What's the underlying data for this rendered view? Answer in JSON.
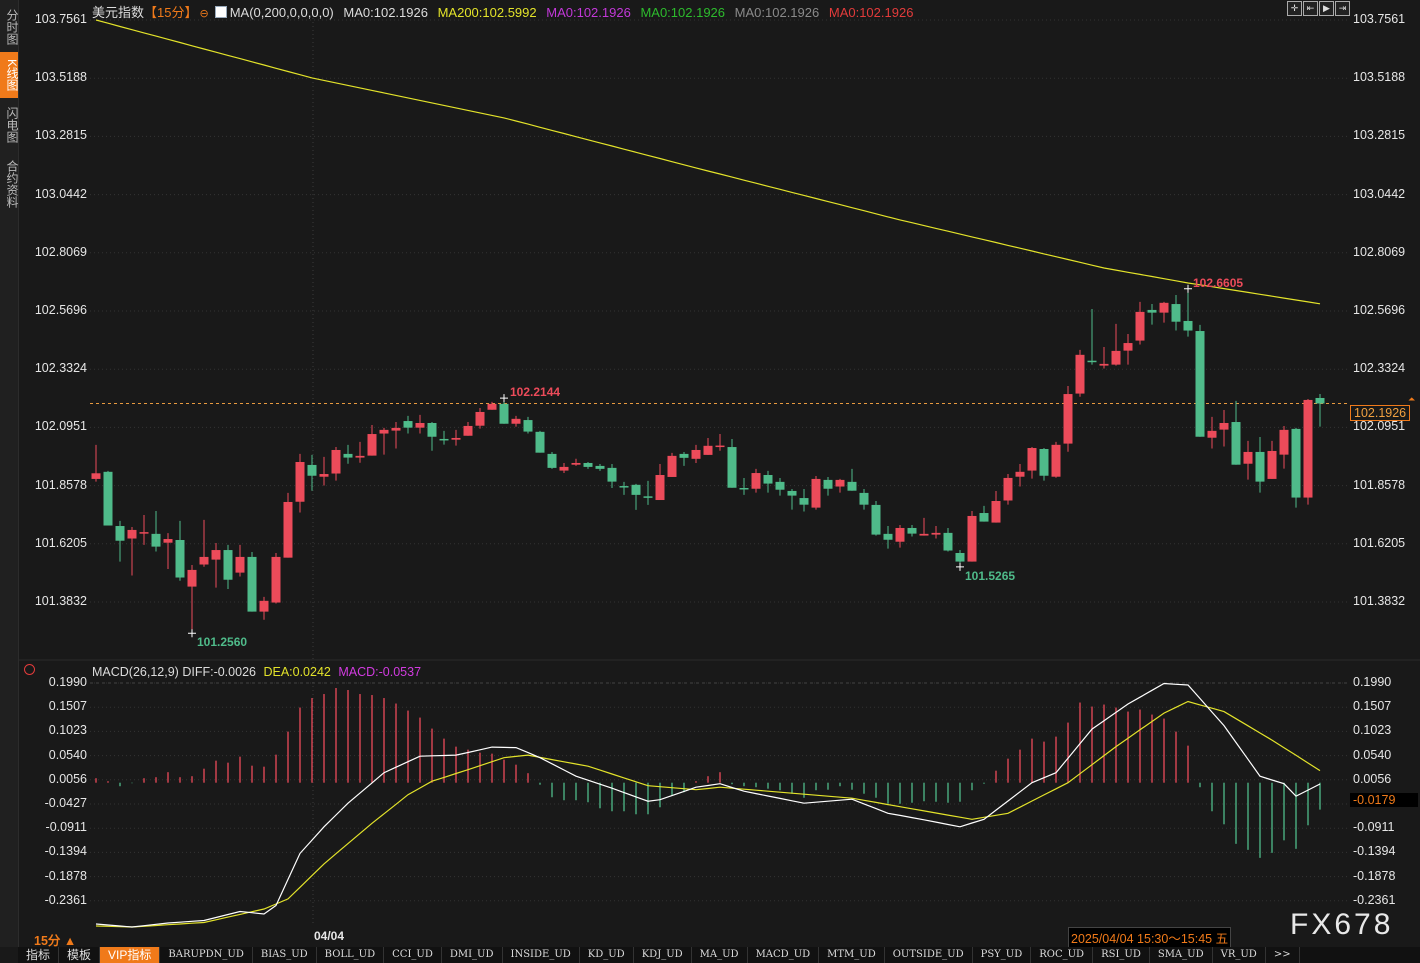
{
  "sidebar": {
    "tabs": [
      {
        "label": "分时图",
        "active": false
      },
      {
        "label": "K线图",
        "active": true
      },
      {
        "label": "闪电图",
        "active": false
      },
      {
        "label": "合约资料",
        "active": false
      }
    ]
  },
  "header": {
    "symbol": "美元指数",
    "period": "【15分】",
    "ma_label": "MA(0,200,0,0,0,0)",
    "ma_values": [
      {
        "text": "MA0:102.1926",
        "color": "#dcdcdc"
      },
      {
        "text": "MA200:102.5992",
        "color": "#e3e32a"
      },
      {
        "text": "MA0:102.1926",
        "color": "#c238d8"
      },
      {
        "text": "MA0:102.1926",
        "color": "#2dbb2d"
      },
      {
        "text": "MA0:102.1926",
        "color": "#8a8a8a"
      },
      {
        "text": "MA0:102.1926",
        "color": "#e23b3b"
      }
    ]
  },
  "toolbar_icons": [
    "crosshair-icon",
    "zoom-start-icon",
    "play-icon",
    "zoom-end-icon"
  ],
  "colors": {
    "up": "#ec4b5a",
    "down": "#4fbb8a",
    "ma200": "#e3e32a",
    "diff": "#ffffff",
    "dea": "#e3e32a",
    "accent": "#f07a1a",
    "background": "#191919"
  },
  "price_axis": {
    "labels": [
      "103.7561",
      "103.5188",
      "103.2815",
      "103.0442",
      "102.8069",
      "102.5696",
      "102.3324",
      "102.0951",
      "101.8578",
      "101.6205",
      "101.3832"
    ],
    "range": [
      101.3832,
      103.7561
    ]
  },
  "last_price": "102.1926",
  "annotations": {
    "high_1": "102.2144",
    "low_1": "101.2560",
    "low_2": "101.5265",
    "high_2": "102.6605"
  },
  "macd": {
    "title": "MACD(26,12,9)",
    "diff_label": "DIFF:-0.0026",
    "dea_label": "DEA:0.0242",
    "macd_label": "MACD:-0.0537",
    "axis_labels": [
      "0.1990",
      "0.1507",
      "0.1023",
      "0.0540",
      "0.0056",
      "-0.0427",
      "-0.0911",
      "-0.1394",
      "-0.1878",
      "-0.2361"
    ],
    "range": [
      -0.2361,
      0.199
    ],
    "cursor_value": "-0.0179"
  },
  "footer": {
    "period": "15分 ▲",
    "date_tick": "04/04",
    "time_range": "2025/04/04 15:30～15:45 五",
    "watermark": "FX678"
  },
  "bottom_tabs": [
    "指标",
    "模板",
    "VIP指标",
    "BARUPDN_UD",
    "BIAS_UD",
    "BOLL_UD",
    "CCI_UD",
    "DMI_UD",
    "INSIDE_UD",
    "KD_UD",
    "KDJ_UD",
    "MA_UD",
    "MACD_UD",
    "MTM_UD",
    "OUTSIDE_UD",
    "PSY_UD",
    "ROC_UD",
    "RSI_UD",
    "SMA_UD",
    "VR_UD",
    ">>"
  ],
  "chart_data": {
    "type": "candlestick",
    "ohlc_fields": [
      "open",
      "high",
      "low",
      "close"
    ],
    "ohlc": [
      [
        101.885,
        102.024,
        101.874,
        101.908
      ],
      [
        101.914,
        101.918,
        101.695,
        101.695
      ],
      [
        101.693,
        101.714,
        101.548,
        101.633
      ],
      [
        101.642,
        101.689,
        101.491,
        101.677
      ],
      [
        101.662,
        101.738,
        101.616,
        101.668
      ],
      [
        101.661,
        101.754,
        101.589,
        101.609
      ],
      [
        101.625,
        101.664,
        101.518,
        101.64
      ],
      [
        101.636,
        101.714,
        101.47,
        101.483
      ],
      [
        101.446,
        101.534,
        101.256,
        101.514
      ],
      [
        101.536,
        101.718,
        101.527,
        101.567
      ],
      [
        101.556,
        101.624,
        101.442,
        101.595
      ],
      [
        101.595,
        101.616,
        101.436,
        101.474
      ],
      [
        101.503,
        101.616,
        101.487,
        101.567
      ],
      [
        101.567,
        101.587,
        101.344,
        101.344
      ],
      [
        101.344,
        101.404,
        101.311,
        101.388
      ],
      [
        101.381,
        101.583,
        101.377,
        101.567
      ],
      [
        101.564,
        101.828,
        101.564,
        101.791
      ],
      [
        101.792,
        101.987,
        101.748,
        101.954
      ],
      [
        101.942,
        101.983,
        101.837,
        101.898
      ],
      [
        101.894,
        101.975,
        101.858,
        101.905
      ],
      [
        101.907,
        102.015,
        101.878,
        102.003
      ],
      [
        101.987,
        102.024,
        101.947,
        101.972
      ],
      [
        101.972,
        102.036,
        101.951,
        101.979
      ],
      [
        101.98,
        102.105,
        101.98,
        102.068
      ],
      [
        102.07,
        102.093,
        101.984,
        102.085
      ],
      [
        102.082,
        102.117,
        102.009,
        102.093
      ],
      [
        102.121,
        102.142,
        102.07,
        102.094
      ],
      [
        102.094,
        102.146,
        102.07,
        102.113
      ],
      [
        102.113,
        102.117,
        102.0,
        102.057
      ],
      [
        102.048,
        102.081,
        102.025,
        102.045
      ],
      [
        102.045,
        102.085,
        102.021,
        102.052
      ],
      [
        102.061,
        102.117,
        102.061,
        102.101
      ],
      [
        102.102,
        102.174,
        102.09,
        102.158
      ],
      [
        102.167,
        102.199,
        102.167,
        102.191
      ],
      [
        102.191,
        102.2144,
        102.11,
        102.11
      ],
      [
        102.11,
        102.142,
        102.098,
        102.13
      ],
      [
        102.125,
        102.138,
        102.07,
        102.078
      ],
      [
        102.077,
        102.081,
        101.992,
        101.992
      ],
      [
        101.987,
        101.995,
        101.926,
        101.93
      ],
      [
        101.919,
        101.95,
        101.909,
        101.934
      ],
      [
        101.943,
        101.967,
        101.938,
        101.95
      ],
      [
        101.95,
        101.954,
        101.926,
        101.934
      ],
      [
        101.938,
        101.946,
        101.918,
        101.926
      ],
      [
        101.93,
        101.946,
        101.848,
        101.874
      ],
      [
        101.856,
        101.873,
        101.82,
        101.854
      ],
      [
        101.861,
        101.865,
        101.759,
        101.82
      ],
      [
        101.814,
        101.877,
        101.779,
        101.81
      ],
      [
        101.799,
        101.946,
        101.799,
        101.901
      ],
      [
        101.893,
        101.991,
        101.893,
        101.979
      ],
      [
        101.987,
        101.995,
        101.938,
        101.971
      ],
      [
        101.967,
        102.024,
        101.95,
        102.003
      ],
      [
        101.983,
        102.052,
        101.983,
        102.02
      ],
      [
        102.018,
        102.068,
        102.0,
        102.021
      ],
      [
        102.015,
        102.048,
        101.849,
        101.849
      ],
      [
        101.848,
        101.889,
        101.82,
        101.843
      ],
      [
        101.845,
        101.926,
        101.829,
        101.909
      ],
      [
        101.901,
        101.918,
        101.829,
        101.866
      ],
      [
        101.873,
        101.889,
        101.817,
        101.841
      ],
      [
        101.836,
        101.844,
        101.76,
        101.817
      ],
      [
        101.807,
        101.844,
        101.752,
        101.78
      ],
      [
        101.768,
        101.897,
        101.76,
        101.885
      ],
      [
        101.881,
        101.893,
        101.817,
        101.845
      ],
      [
        101.854,
        101.885,
        101.829,
        101.881
      ],
      [
        101.873,
        101.926,
        101.837,
        101.837
      ],
      [
        101.828,
        101.844,
        101.76,
        101.78
      ],
      [
        101.779,
        101.795,
        101.654,
        101.658
      ],
      [
        101.661,
        101.693,
        101.601,
        101.637
      ],
      [
        101.629,
        101.697,
        101.605,
        101.685
      ],
      [
        101.685,
        101.697,
        101.65,
        101.662
      ],
      [
        101.654,
        101.726,
        101.654,
        101.661
      ],
      [
        101.658,
        101.693,
        101.642,
        101.665
      ],
      [
        101.665,
        101.685,
        101.589,
        101.593
      ],
      [
        101.583,
        101.595,
        101.5265,
        101.548
      ],
      [
        101.548,
        101.754,
        101.548,
        101.734
      ],
      [
        101.746,
        101.775,
        101.711,
        101.711
      ],
      [
        101.707,
        101.836,
        101.707,
        101.795
      ],
      [
        101.797,
        101.905,
        101.78,
        101.889
      ],
      [
        101.894,
        101.946,
        101.854,
        101.914
      ],
      [
        101.919,
        102.015,
        101.886,
        102.011
      ],
      [
        102.007,
        102.011,
        101.878,
        101.898
      ],
      [
        101.894,
        102.036,
        101.89,
        102.024
      ],
      [
        102.029,
        102.264,
        101.996,
        102.231
      ],
      [
        102.233,
        102.411,
        102.22,
        102.391
      ],
      [
        102.367,
        102.578,
        102.351,
        102.363
      ],
      [
        102.347,
        102.423,
        102.335,
        102.354
      ],
      [
        102.351,
        102.517,
        102.347,
        102.407
      ],
      [
        102.408,
        102.476,
        102.351,
        102.439
      ],
      [
        102.449,
        102.607,
        102.433,
        102.566
      ],
      [
        102.574,
        102.598,
        102.514,
        102.563
      ],
      [
        102.563,
        102.607,
        102.522,
        102.603
      ],
      [
        102.598,
        102.635,
        102.49,
        102.526
      ],
      [
        102.529,
        102.6605,
        102.465,
        102.49
      ],
      [
        102.488,
        102.513,
        102.057,
        102.057
      ],
      [
        102.053,
        102.138,
        102.009,
        102.081
      ],
      [
        102.086,
        102.166,
        102.017,
        102.113
      ],
      [
        102.117,
        102.203,
        101.943,
        101.943
      ],
      [
        101.947,
        102.04,
        101.882,
        101.995
      ],
      [
        101.995,
        102.056,
        101.829,
        101.874
      ],
      [
        101.885,
        102.04,
        101.885,
        101.999
      ],
      [
        101.984,
        102.101,
        101.927,
        102.085
      ],
      [
        102.089,
        102.093,
        101.768,
        101.809
      ],
      [
        101.809,
        102.211,
        101.78,
        102.207
      ],
      [
        102.215,
        102.231,
        102.098,
        102.1926
      ]
    ],
    "ma200_points": [
      [
        1,
        103.756
      ],
      [
        19,
        103.52
      ],
      [
        35,
        103.357
      ],
      [
        51,
        103.153
      ],
      [
        68,
        102.941
      ],
      [
        85,
        102.745
      ],
      [
        92,
        102.684
      ],
      [
        103,
        102.5992
      ]
    ],
    "macd_hist": [
      0.009,
      0.003,
      -0.007,
      -0.001,
      0.009,
      0.011,
      0.021,
      0.011,
      0.013,
      0.028,
      0.044,
      0.04,
      0.052,
      0.034,
      0.032,
      0.056,
      0.102,
      0.15,
      0.169,
      0.177,
      0.189,
      0.185,
      0.177,
      0.175,
      0.169,
      0.158,
      0.144,
      0.13,
      0.108,
      0.088,
      0.072,
      0.066,
      0.06,
      0.058,
      0.046,
      0.036,
      0.019,
      -0.004,
      -0.029,
      -0.035,
      -0.035,
      -0.039,
      -0.051,
      -0.057,
      -0.057,
      -0.063,
      -0.063,
      -0.049,
      -0.025,
      -0.019,
      0.003,
      0.013,
      0.021,
      -0.003,
      -0.007,
      -0.009,
      -0.012,
      -0.015,
      -0.022,
      -0.03,
      -0.015,
      -0.014,
      -0.007,
      -0.014,
      -0.022,
      -0.03,
      -0.042,
      -0.042,
      -0.04,
      -0.037,
      -0.038,
      -0.04,
      -0.038,
      -0.015,
      -0.002,
      0.024,
      0.048,
      0.066,
      0.088,
      0.082,
      0.092,
      0.12,
      0.16,
      0.152,
      0.156,
      0.15,
      0.142,
      0.146,
      0.136,
      0.128,
      0.102,
      0.074,
      -0.009,
      -0.057,
      -0.083,
      -0.122,
      -0.134,
      -0.15,
      -0.14,
      -0.115,
      -0.132,
      -0.085,
      -0.0537
    ],
    "diff_points": [
      [
        1,
        -0.282
      ],
      [
        4,
        -0.288
      ],
      [
        7,
        -0.28
      ],
      [
        10,
        -0.275
      ],
      [
        13,
        -0.257
      ],
      [
        15,
        -0.262
      ],
      [
        16,
        -0.245
      ],
      [
        18,
        -0.141
      ],
      [
        20,
        -0.088
      ],
      [
        22,
        -0.041
      ],
      [
        25,
        0.02
      ],
      [
        28,
        0.053
      ],
      [
        31,
        0.055
      ],
      [
        34,
        0.071
      ],
      [
        36,
        0.07
      ],
      [
        38,
        0.05
      ],
      [
        41,
        0.013
      ],
      [
        44,
        -0.011
      ],
      [
        47,
        -0.037
      ],
      [
        48,
        -0.034
      ],
      [
        51,
        -0.009
      ],
      [
        53,
        -0.002
      ],
      [
        55,
        -0.017
      ],
      [
        60,
        -0.041
      ],
      [
        64,
        -0.033
      ],
      [
        67,
        -0.061
      ],
      [
        70,
        -0.074
      ],
      [
        73,
        -0.088
      ],
      [
        75,
        -0.073
      ],
      [
        79,
        0.0
      ],
      [
        81,
        0.02
      ],
      [
        84,
        0.107
      ],
      [
        87,
        0.157
      ],
      [
        90,
        0.198
      ],
      [
        92,
        0.195
      ],
      [
        95,
        0.114
      ],
      [
        98,
        0.013
      ],
      [
        100,
        -0.002
      ],
      [
        101,
        -0.027
      ],
      [
        103,
        -0.0026
      ]
    ],
    "dea_points": [
      [
        1,
        -0.286
      ],
      [
        4,
        -0.288
      ],
      [
        10,
        -0.279
      ],
      [
        15,
        -0.252
      ],
      [
        17,
        -0.232
      ],
      [
        20,
        -0.162
      ],
      [
        24,
        -0.081
      ],
      [
        27,
        -0.024
      ],
      [
        29,
        0.003
      ],
      [
        32,
        0.026
      ],
      [
        35,
        0.05
      ],
      [
        37,
        0.055
      ],
      [
        42,
        0.033
      ],
      [
        47,
        -0.006
      ],
      [
        51,
        -0.014
      ],
      [
        53,
        -0.009
      ],
      [
        59,
        -0.021
      ],
      [
        64,
        -0.031
      ],
      [
        74,
        -0.073
      ],
      [
        77,
        -0.061
      ],
      [
        82,
        0.0
      ],
      [
        86,
        0.072
      ],
      [
        90,
        0.139
      ],
      [
        92,
        0.162
      ],
      [
        95,
        0.142
      ],
      [
        99,
        0.085
      ],
      [
        103,
        0.0242
      ]
    ],
    "grid": true
  }
}
